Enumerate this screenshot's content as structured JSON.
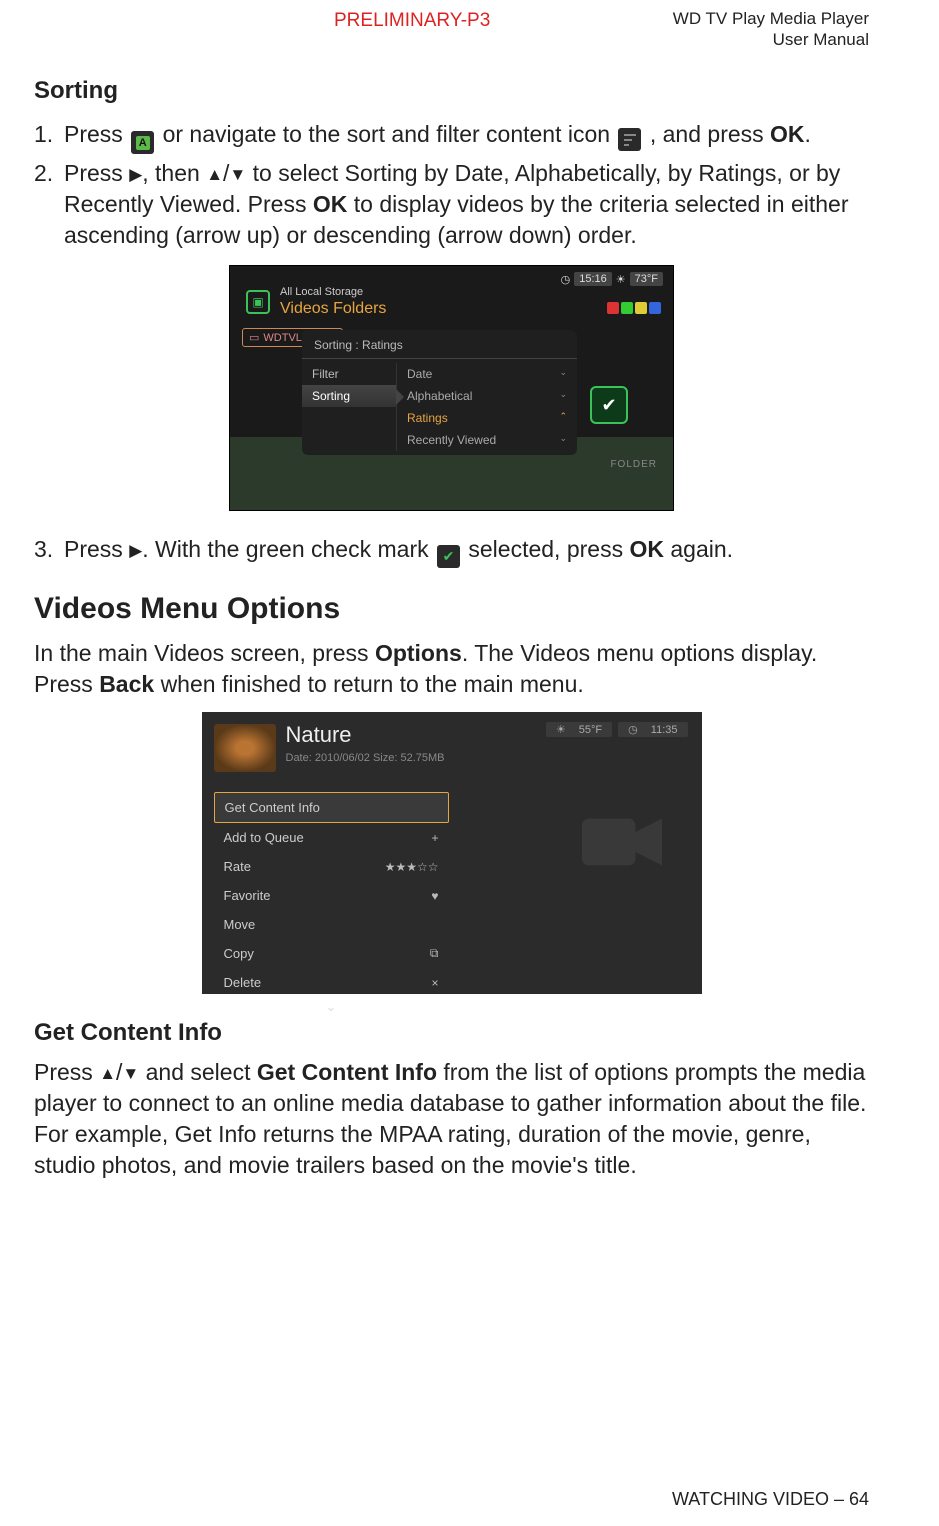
{
  "header": {
    "preliminary": "PRELIMINARY-P3",
    "product": "WD TV Play Media Player",
    "doc": "User Manual"
  },
  "section_sorting": {
    "title": "Sorting",
    "step1_a": "Press",
    "step1_b": "or navigate to the sort and filter content icon",
    "step1_c": ", and press",
    "step1_d": "OK",
    "step1_e": ".",
    "step2_a": "Press",
    "step2_b": ", then",
    "step2_c": "to select Sorting by Date, Alphabetically, by Ratings, or by Recently Viewed. Press",
    "step2_d": "OK",
    "step2_e": "to display videos by the criteria selected in either ascending (arrow up) or descending (arrow down) order.",
    "step3_a": "Press",
    "step3_b": ". With the green check mark",
    "step3_c": "selected, press",
    "step3_d": "OK",
    "step3_e": "again."
  },
  "shot1": {
    "time": "15:16",
    "temp": "73°F",
    "storage": "All Local Storage",
    "folders": "Videos  Folders",
    "hub": "WDTVLiveHub",
    "menu_title": "Sorting : Ratings",
    "left_filter": "Filter",
    "left_sorting": "Sorting",
    "r_date": "Date",
    "r_alpha": "Alphabetical",
    "r_ratings": "Ratings",
    "r_recent": "Recently Viewed",
    "folder": "FOLDER"
  },
  "section_options": {
    "title": "Videos Menu Options",
    "para_a": "In the main Videos screen, press",
    "para_b": "Options",
    "para_c": ". The Videos menu options display. Press",
    "para_d": "Back",
    "para_e": "when finished to return to the main menu."
  },
  "shot2": {
    "title": "Nature",
    "meta": "Date: 2010/06/02    Size: 52.75MB",
    "temp": "55°F",
    "time": "11:35",
    "opt1": "Get Content Info",
    "opt2": "Add to Queue",
    "opt3": "Rate",
    "opt4": "Favorite",
    "opt5": "Move",
    "opt6": "Copy",
    "opt7": "Delete",
    "stars": "★★★☆☆"
  },
  "section_getinfo": {
    "title": "Get Content Info",
    "para_a": "Press",
    "para_b": "and select",
    "para_c": "Get Content Info",
    "para_d": "from the list of options prompts the media player to connect to an online media database to gather information about the file. For example, Get Info returns the MPAA rating, duration of the movie, genre, studio photos, and movie trailers based on the movie's title."
  },
  "footer": {
    "text": "WATCHING VIDEO – 64"
  }
}
